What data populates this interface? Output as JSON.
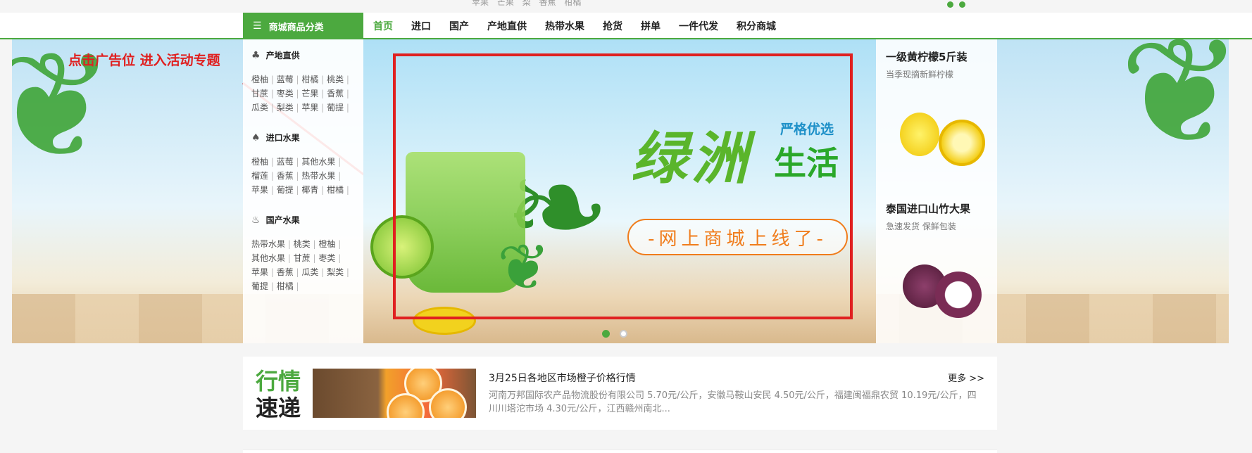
{
  "hot_keywords": [
    "苹果",
    "芒果",
    "梨",
    "香蕉",
    "柑橘"
  ],
  "nav": {
    "category_button": "商城商品分类",
    "items": [
      "首页",
      "进口",
      "国产",
      "产地直供",
      "热带水果",
      "抢货",
      "拼单",
      "一件代发",
      "积分商城"
    ],
    "active_index": 0
  },
  "annotation": {
    "text": "点击广告位 进入活动专题",
    "color": "#e02020"
  },
  "categories": [
    {
      "title": "产地直供",
      "icon": "palm-tree-icon",
      "links": [
        "橙柚",
        "蓝莓",
        "柑橘",
        "桃类",
        "甘蔗",
        "枣类",
        "芒果",
        "香蕉",
        "瓜类",
        "梨类",
        "苹果",
        "葡提"
      ]
    },
    {
      "title": "进口水果",
      "icon": "cherry-icon",
      "links": [
        "橙柚",
        "蓝莓",
        "其他水果",
        "榴莲",
        "香蕉",
        "热带水果",
        "苹果",
        "葡提",
        "椰青",
        "柑橘"
      ]
    },
    {
      "title": "国产水果",
      "icon": "fruit-basket-icon",
      "links": [
        "热带水果",
        "桃类",
        "橙柚",
        "其他水果",
        "甘蔗",
        "枣类",
        "苹果",
        "香蕉",
        "瓜类",
        "梨类",
        "葡提",
        "柑橘"
      ]
    }
  ],
  "banner": {
    "headline": "绿洲",
    "tag": "严格优选",
    "life": "生活",
    "online": "-网上商城上线了-",
    "slides": 2,
    "active_slide": 0
  },
  "promos": [
    {
      "title": "一级黄柠檬5斤装",
      "subtitle": "当季现摘新鲜柠檬",
      "image": "lemon"
    },
    {
      "title": "泰国进口山竹大果",
      "subtitle": "急速发货 保鲜包装",
      "image": "mangosteen"
    }
  ],
  "market_news": {
    "badge_top": "行情",
    "badge_bottom": "速递",
    "title": "3月25日各地区市场橙子价格行情",
    "more": "更多 >>",
    "body": "河南万邦国际农产品物流股份有限公司 5.70元/公斤，安徽马鞍山安民 4.50元/公斤，福建闽福鼎农贸 10.19元/公斤，四川川塔沱市场 4.30元/公斤，江西赣州南北..."
  },
  "colors": {
    "brand_green": "#4ca93f",
    "highlight_red": "#e02020",
    "cta_orange": "#f07c1b"
  }
}
